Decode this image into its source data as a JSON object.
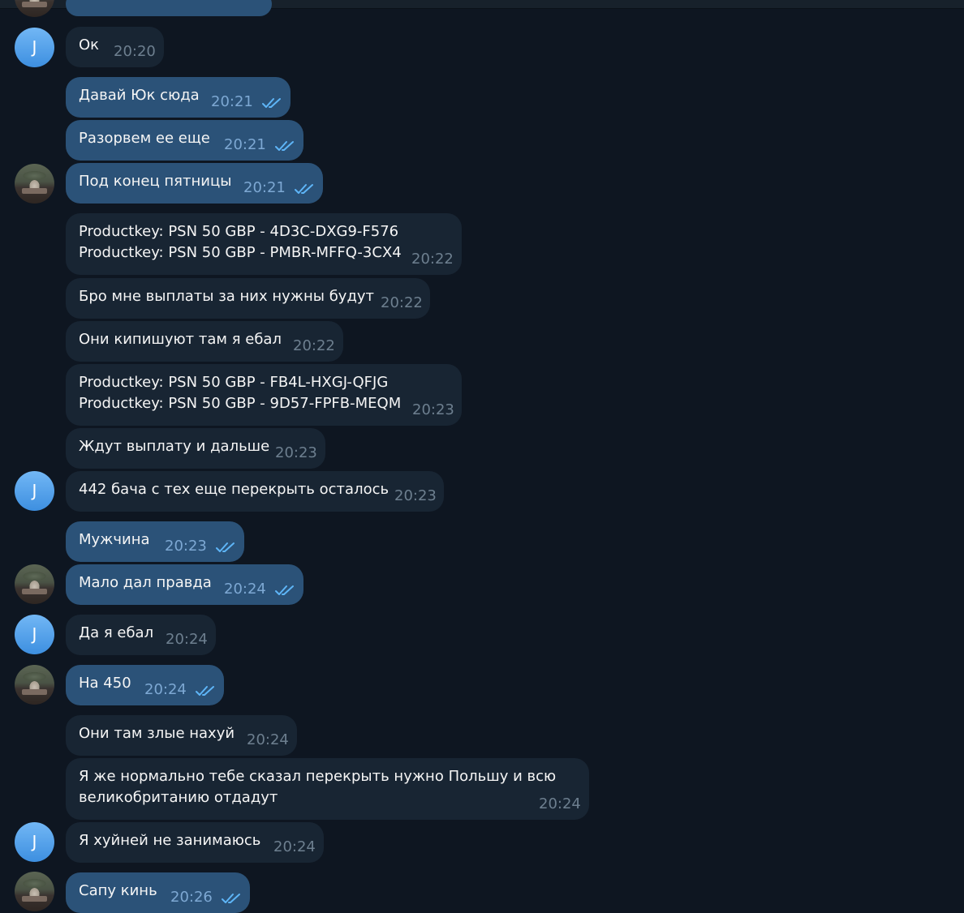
{
  "messages": [
    {
      "text": "Ок",
      "time": "20:20"
    },
    {
      "text": "Давай Юк сюда",
      "time": "20:21"
    },
    {
      "text": "Разорвем ее еще",
      "time": "20:21"
    },
    {
      "text": "Под конец пятницы",
      "time": "20:21"
    },
    {
      "line1": "Productkey: PSN 50 GBP - 4D3C-DXG9-F576",
      "line2": "Productkey: PSN 50 GBP - PMBR-MFFQ-3CX4",
      "time": "20:22"
    },
    {
      "text": "Бро мне выплаты за них нужны будут",
      "time": "20:22"
    },
    {
      "text": "Они кипишуют там я ебал",
      "time": "20:22"
    },
    {
      "line1": "Productkey: PSN 50 GBP - FB4L-HXGJ-QFJG",
      "line2": "Productkey: PSN 50 GBP - 9D57-FPFB-MEQM",
      "time": "20:23"
    },
    {
      "text": "Ждут выплату и дальше",
      "time": "20:23"
    },
    {
      "text": "442 бача с тех еще перекрыть осталось",
      "time": "20:23"
    },
    {
      "text": "Мужчина",
      "time": "20:23"
    },
    {
      "text": "Мало дал правда",
      "time": "20:24"
    },
    {
      "text": "Да я ебал",
      "time": "20:24"
    },
    {
      "text": "На 450",
      "time": "20:24"
    },
    {
      "text": "Они там злые нахуй",
      "time": "20:24"
    },
    {
      "line1": "Я же нормально тебе сказал перекрыть нужно Польшу и всю",
      "line2": "великобританию отдадут",
      "time": "20:24"
    },
    {
      "text": "Я хуйней не занимаюсь",
      "time": "20:24"
    },
    {
      "text": "Сапу кинь",
      "time": "20:26"
    }
  ],
  "contact_initial": "J",
  "colors": {
    "background": "#0e1621",
    "incoming_bubble": "#182533",
    "outgoing_bubble": "#2b5278",
    "read_check": "#5eb5f7",
    "avatar_gradient_top": "#72b7f5",
    "avatar_gradient_bottom": "#3d8fe0"
  },
  "icons": {
    "read_status": "double-check-icon"
  }
}
